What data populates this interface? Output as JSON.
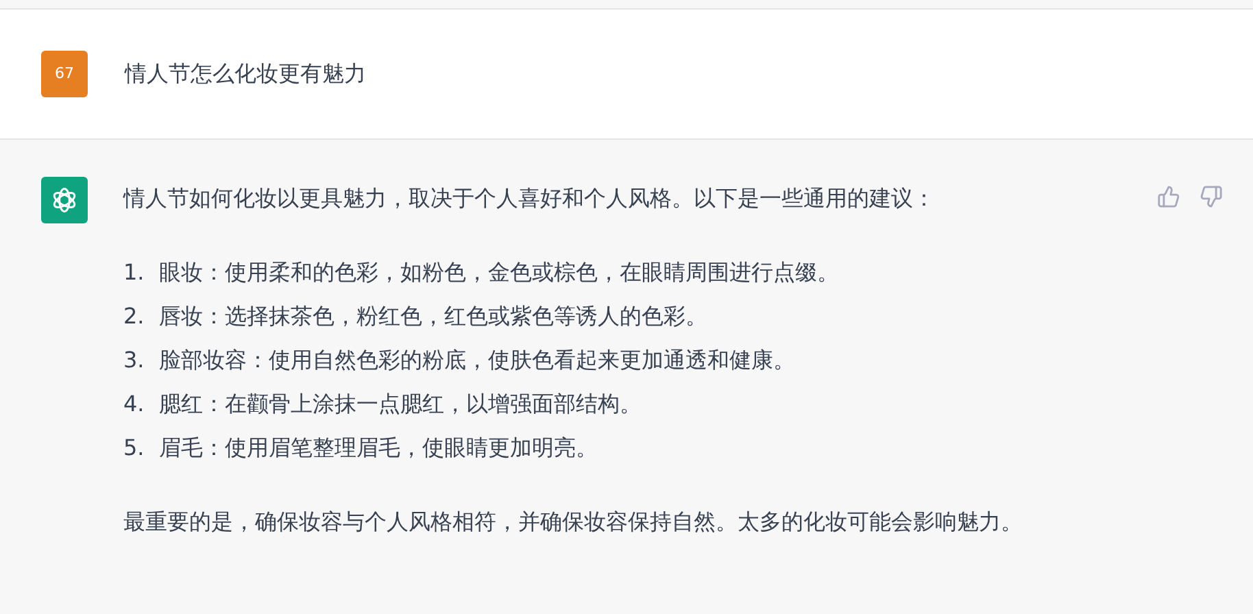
{
  "user_message": {
    "avatar": "67",
    "text": "情人节怎么化妆更有魅力"
  },
  "assistant_message": {
    "intro": "情人节如何化妆以更具魅力，取决于个人喜好和个人风格。以下是一些通用的建议：",
    "items": [
      {
        "number": "1.",
        "text": "眼妆：使用柔和的色彩，如粉色，金色或棕色，在眼睛周围进行点缀。"
      },
      {
        "number": "2.",
        "text": "唇妆：选择抹茶色，粉红色，红色或紫色等诱人的色彩。"
      },
      {
        "number": "3.",
        "text": "脸部妆容：使用自然色彩的粉底，使肤色看起来更加通透和健康。"
      },
      {
        "number": "4.",
        "text": "腮红：在颧骨上涂抹一点腮红，以增强面部结构。"
      },
      {
        "number": "5.",
        "text": "眉毛：使用眉笔整理眉毛，使眼睛更加明亮。"
      }
    ],
    "conclusion": "最重要的是，确保妆容与个人风格相符，并确保妆容保持自然。太多的化妆可能会影响魅力。"
  }
}
